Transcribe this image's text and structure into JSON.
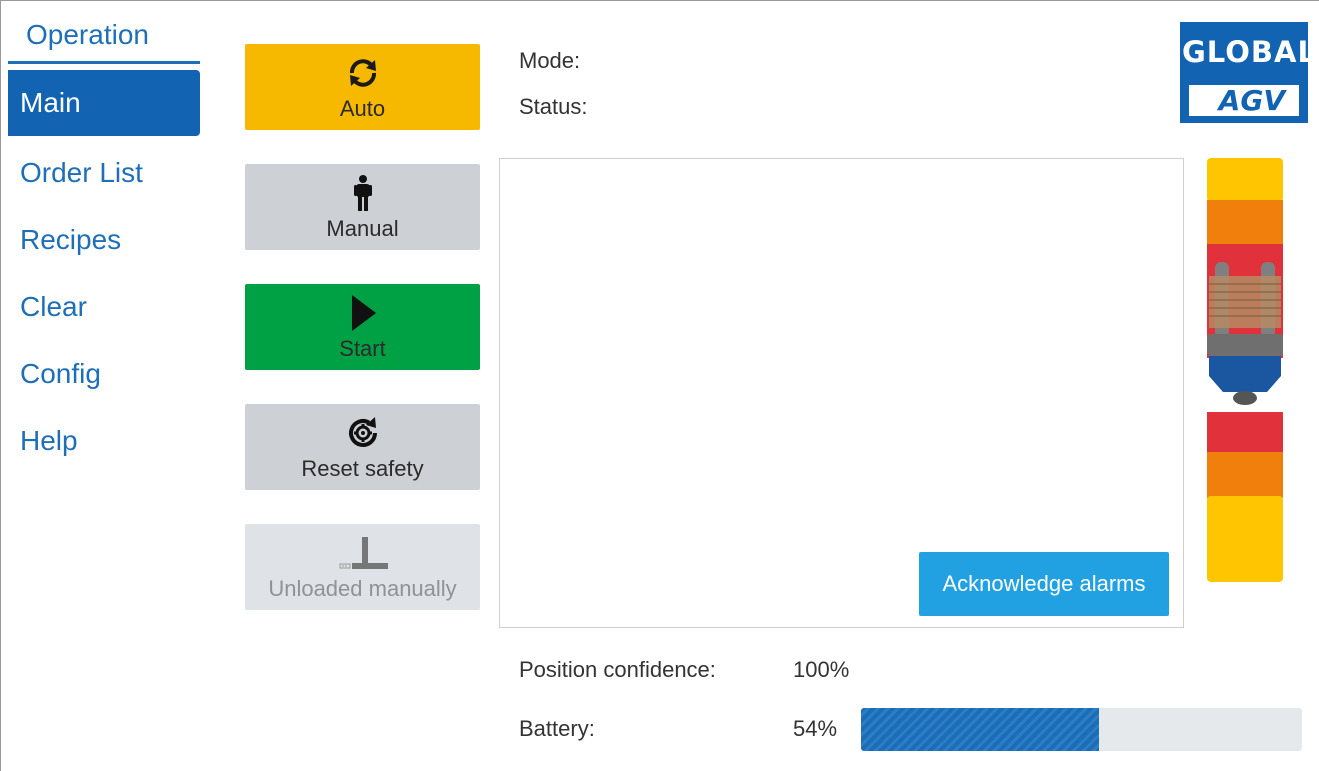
{
  "sidebar": {
    "title": "Operation",
    "items": [
      {
        "label": "Main",
        "active": true
      },
      {
        "label": "Order List",
        "active": false
      },
      {
        "label": "Recipes",
        "active": false
      },
      {
        "label": "Clear",
        "active": false
      },
      {
        "label": "Config",
        "active": false
      },
      {
        "label": "Help",
        "active": false
      }
    ]
  },
  "buttons": {
    "auto": {
      "label": "Auto",
      "icon": "refresh-icon",
      "color": "#f7b800"
    },
    "manual": {
      "label": "Manual",
      "icon": "person-icon",
      "color": "#cdd1d6"
    },
    "start": {
      "label": "Start",
      "icon": "play-icon",
      "color": "#00a044"
    },
    "reset_safety": {
      "label": "Reset safety",
      "icon": "reset-gear-icon",
      "color": "#cdd1d6"
    },
    "unloaded_manually": {
      "label": "Unloaded manually",
      "icon": "forklift-fork-icon",
      "disabled": true
    }
  },
  "info": {
    "mode_label": "Mode:",
    "status_label": "Status:"
  },
  "alarms": {
    "acknowledge_label": "Acknowledge alarms"
  },
  "logo": {
    "top": "GLOBAL",
    "bottom": "AGV"
  },
  "footer": {
    "position_confidence_label": "Position confidence:",
    "position_confidence_value": "100%",
    "battery_label": "Battery:",
    "battery_value": "54%",
    "battery_fraction": 0.54
  },
  "colors": {
    "accent": "#1264b3",
    "auto": "#f7b800",
    "start": "#00a044",
    "acknowledge": "#21a1e1"
  }
}
